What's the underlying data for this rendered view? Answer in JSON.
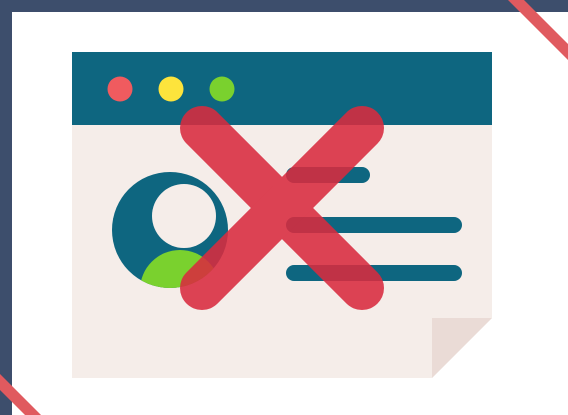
{
  "illustration": {
    "icon": "user-profile-page-blocked-icon",
    "colors": {
      "frame": "#3d4e6c",
      "panel": "#ffffff",
      "corner_stripe": "#e05a5f",
      "document": "#f5ede9",
      "document_fold": "#eadbd6",
      "titlebar": "#0e6680",
      "traffic_red": "#f05b5f",
      "traffic_yellow": "#fde43c",
      "traffic_green": "#7ad12e",
      "avatar_ring": "#0e6680",
      "avatar_head": "#f5ede9",
      "avatar_body": "#7ad12e",
      "text_lines": "#0e6680",
      "cross": "#d92b3f"
    }
  }
}
